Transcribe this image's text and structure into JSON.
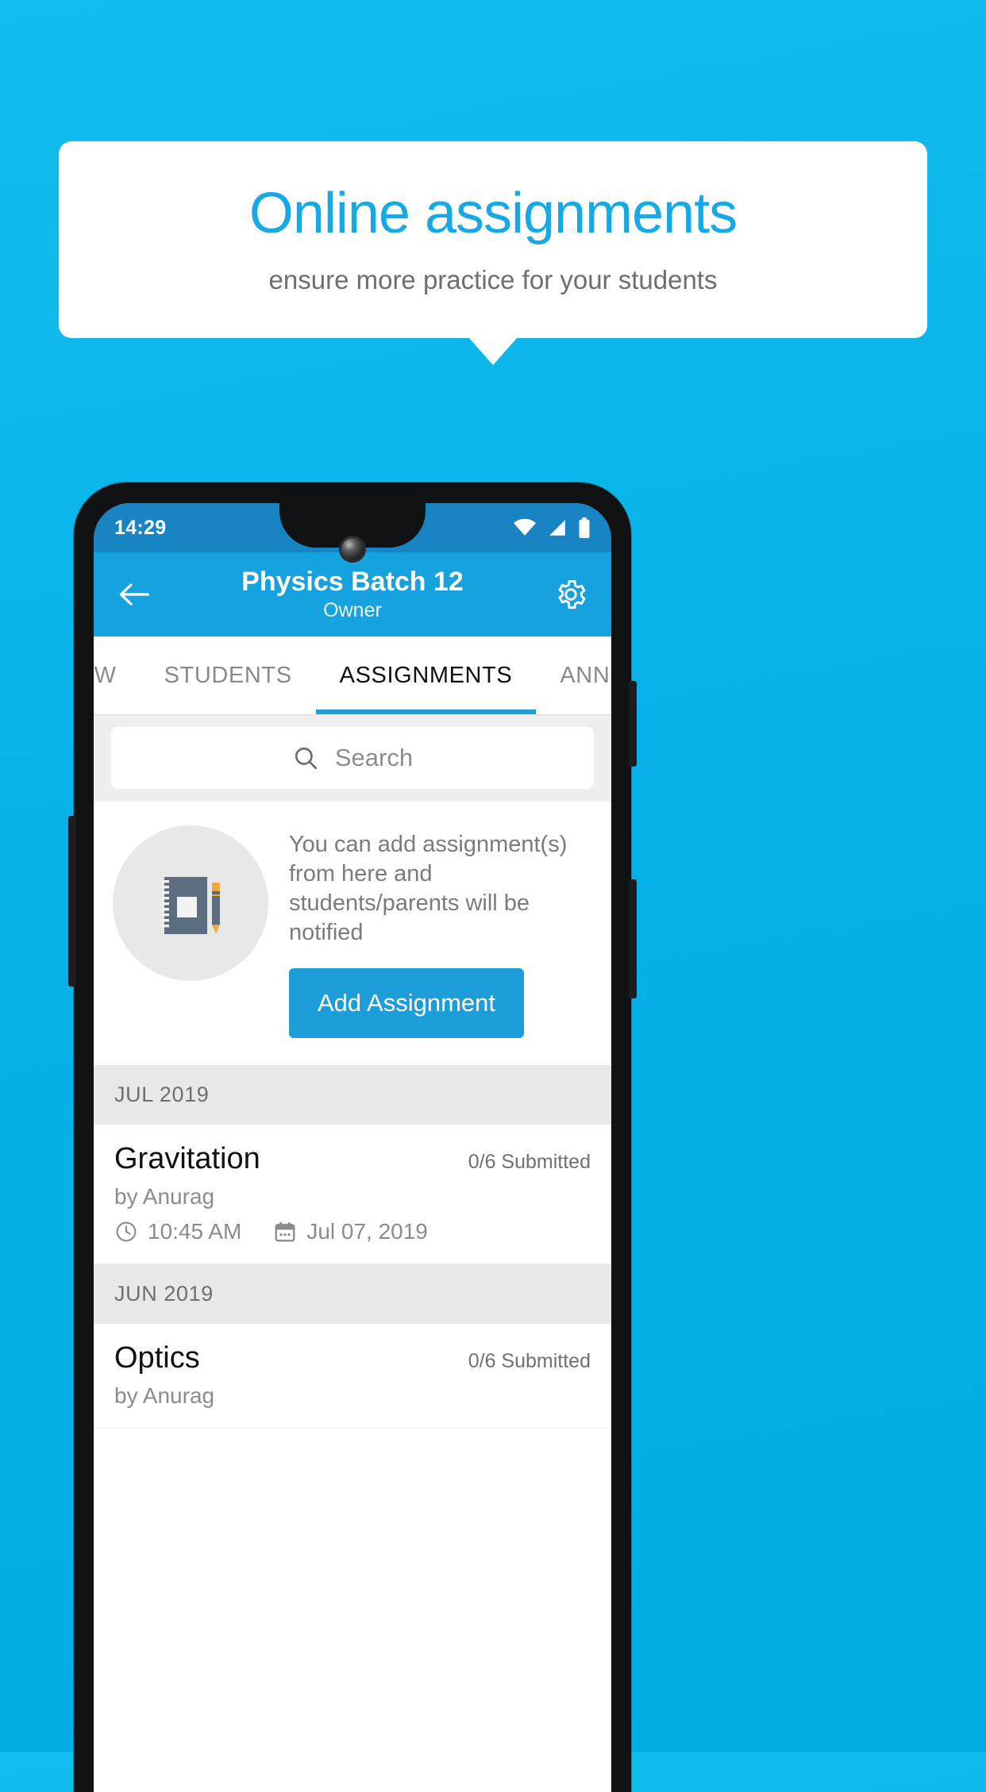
{
  "promo": {
    "title": "Online assignments",
    "subtitle": "ensure more practice for your students",
    "accent_color": "#16a9e5",
    "background_color": "#06b2e8"
  },
  "phone": {
    "status_bar": {
      "time": "14:29",
      "icons": [
        "wifi-icon",
        "signal-icon",
        "battery-icon"
      ],
      "background_color": "#1884c4"
    },
    "appbar": {
      "back_icon": "arrow-left-icon",
      "title": "Physics Batch 12",
      "subtitle": "Owner",
      "settings_icon": "gear-icon",
      "background_color": "#16a2de"
    },
    "tabs": [
      {
        "label": "IEW",
        "active": false
      },
      {
        "label": "STUDENTS",
        "active": false
      },
      {
        "label": "ASSIGNMENTS",
        "active": true
      },
      {
        "label": "ANNOUNCEMENTS",
        "active": false
      }
    ],
    "search": {
      "icon": "search-icon",
      "placeholder": "Search",
      "value": ""
    },
    "info_card": {
      "illustration": "notebook-pen-icon",
      "text": "You can add assignment(s) from here and students/parents will be notified",
      "button_label": "Add Assignment",
      "button_color": "#1d9ed8"
    },
    "groups": [
      {
        "month": "JUL 2019",
        "items": [
          {
            "title": "Gravitation",
            "submitted": "0/6 Submitted",
            "author": "by Anurag",
            "time": "10:45 AM",
            "date": "Jul 07, 2019",
            "time_icon": "clock-icon",
            "date_icon": "calendar-icon"
          }
        ]
      },
      {
        "month": "JUN 2019",
        "items": [
          {
            "title": "Optics",
            "submitted": "0/6 Submitted",
            "author": "by Anurag",
            "time": "",
            "date": "",
            "time_icon": "clock-icon",
            "date_icon": "calendar-icon"
          }
        ]
      }
    ]
  }
}
